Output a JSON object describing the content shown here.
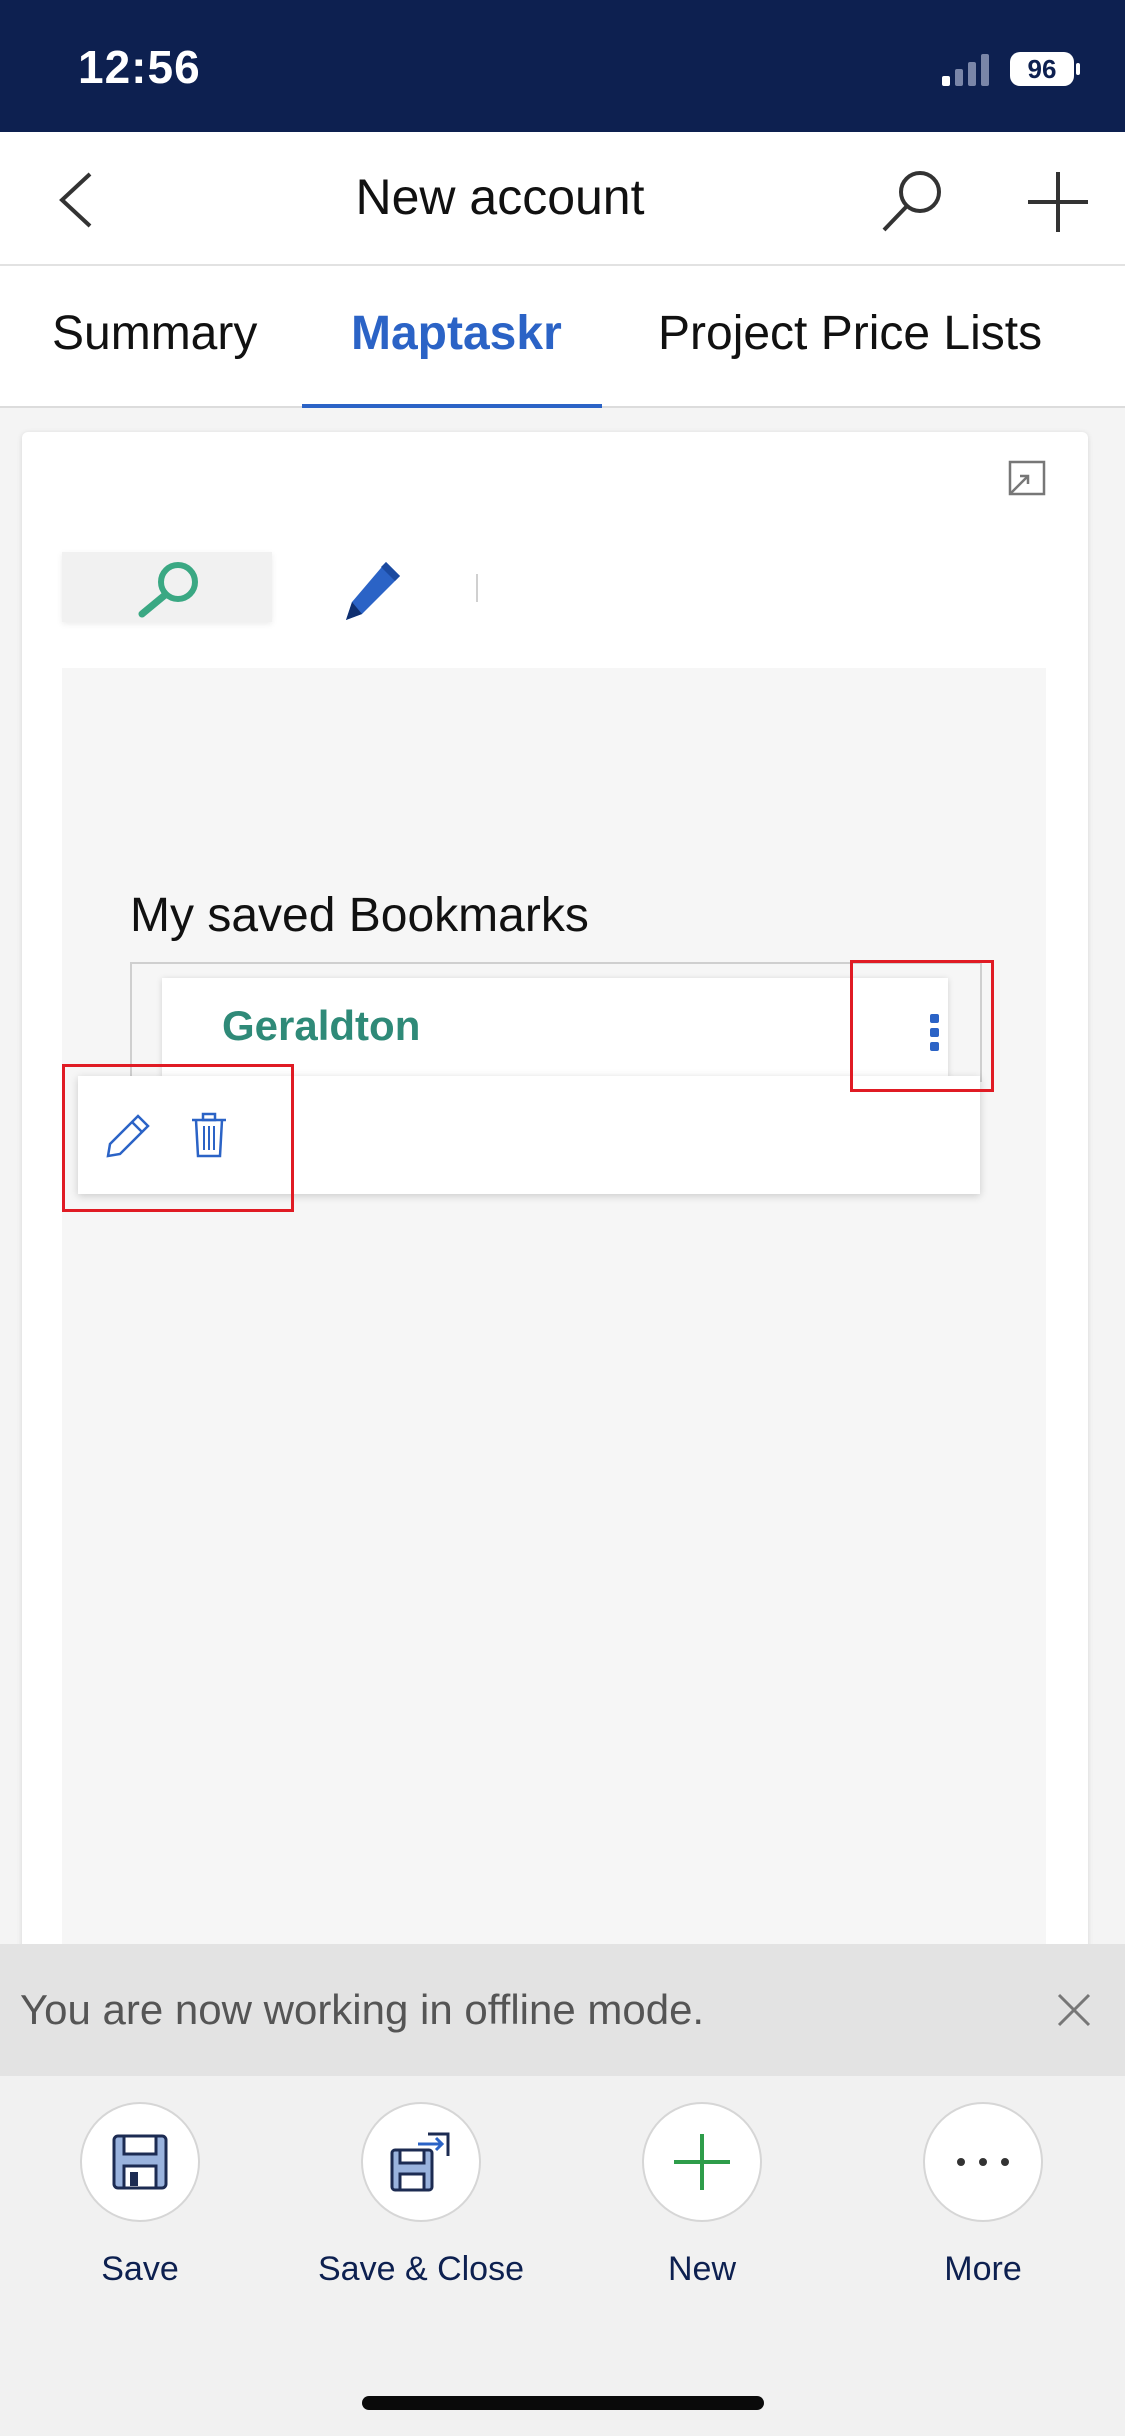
{
  "status_bar": {
    "time": "12:56",
    "battery": "96",
    "signal_icon": "cellular-signal-icon"
  },
  "header": {
    "title": "New account",
    "back_icon": "chevron-left-icon",
    "search_icon": "search-icon",
    "add_icon": "plus-icon"
  },
  "tabs": [
    {
      "label": "Summary",
      "active": false
    },
    {
      "label": "Maptaskr",
      "active": true
    },
    {
      "label": "Project Price Lists",
      "active": false
    }
  ],
  "card": {
    "expand_icon": "expand-icon",
    "toolbar": {
      "search_icon": "map-search-icon",
      "draw_icon": "pencil-icon"
    },
    "bookmarks_heading": "My saved Bookmarks",
    "bookmarks": [
      {
        "name": "Geraldton"
      }
    ],
    "bookmark_menu": {
      "edit_icon": "edit-pencil-icon",
      "delete_icon": "trash-icon"
    }
  },
  "offline_banner": {
    "message": "You are now working in offline mode.",
    "close_icon": "close-icon"
  },
  "command_bar": {
    "buttons": [
      {
        "label": "Save",
        "icon": "save-icon"
      },
      {
        "label": "Save & Close",
        "icon": "save-close-icon"
      },
      {
        "label": "New",
        "icon": "plus-icon"
      },
      {
        "label": "More",
        "icon": "more-icon"
      }
    ]
  },
  "colors": {
    "status_bar": "#0d2050",
    "active_tab": "#2b63c6",
    "bookmark_name": "#2f8a78",
    "highlight": "#e01b24",
    "new_plus": "#2e9d4a"
  }
}
